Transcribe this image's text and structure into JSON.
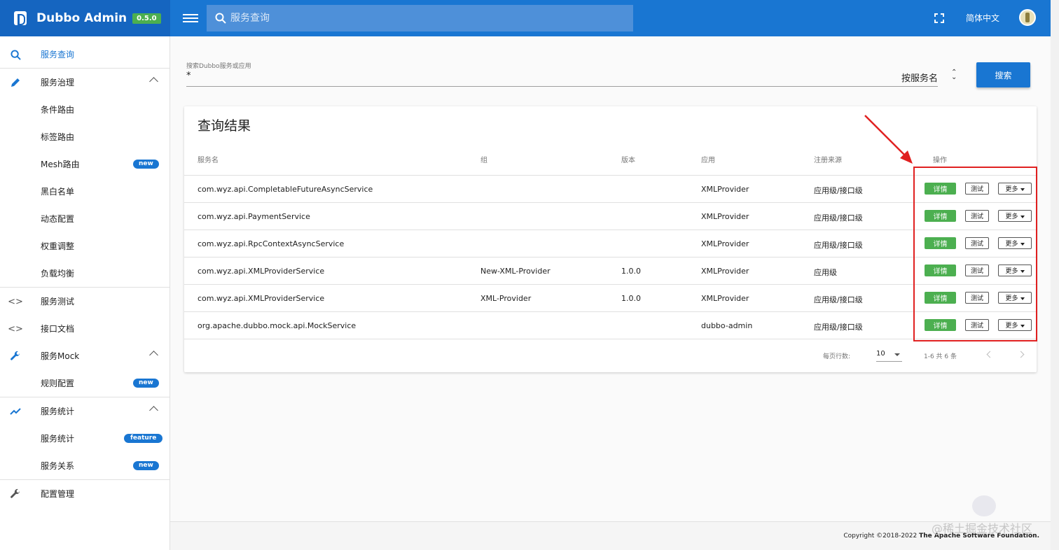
{
  "header": {
    "app_title": "Dubbo Admin",
    "version": "0.5.0",
    "search_placeholder": "服务查询",
    "language": "简体中文",
    "brand_color": "#1976d2"
  },
  "sidebar": {
    "items": [
      {
        "label": "服务查询",
        "icon": "search-icon"
      },
      {
        "label": "服务治理",
        "icon": "pencil-icon"
      },
      {
        "label": "条件路由"
      },
      {
        "label": "标签路由"
      },
      {
        "label": "Mesh路由",
        "badge": "new"
      },
      {
        "label": "黑白名单"
      },
      {
        "label": "动态配置"
      },
      {
        "label": "权重调整"
      },
      {
        "label": "负载均衡"
      },
      {
        "label": "服务测试",
        "icon": "code-icon"
      },
      {
        "label": "接口文档",
        "icon": "code-icon"
      },
      {
        "label": "服务Mock",
        "icon": "wrench-icon"
      },
      {
        "label": "规则配置",
        "badge": "new"
      },
      {
        "label": "服务统计",
        "icon": "trending-up-icon"
      },
      {
        "label": "服务统计",
        "badge": "feature"
      },
      {
        "label": "服务关系",
        "badge": "new"
      },
      {
        "label": "配置管理",
        "icon": "wrench-icon"
      }
    ]
  },
  "filter": {
    "label": "搜索Dubbo服务或应用",
    "value": "*",
    "mode": "按服务名",
    "search_button": "搜索"
  },
  "results": {
    "title": "查询结果",
    "columns": [
      "服务名",
      "组",
      "版本",
      "应用",
      "注册来源",
      "操作"
    ],
    "rows": [
      {
        "service": "com.wyz.api.CompletableFutureAsyncService",
        "group": "",
        "version": "",
        "app": "XMLProvider",
        "source": "应用级/接口级"
      },
      {
        "service": "com.wyz.api.PaymentService",
        "group": "",
        "version": "",
        "app": "XMLProvider",
        "source": "应用级/接口级"
      },
      {
        "service": "com.wyz.api.RpcContextAsyncService",
        "group": "",
        "version": "",
        "app": "XMLProvider",
        "source": "应用级/接口级"
      },
      {
        "service": "com.wyz.api.XMLProviderService",
        "group": "New-XML-Provider",
        "version": "1.0.0",
        "app": "XMLProvider",
        "source": "应用级"
      },
      {
        "service": "com.wyz.api.XMLProviderService",
        "group": "XML-Provider",
        "version": "1.0.0",
        "app": "XMLProvider",
        "source": "应用级/接口级"
      },
      {
        "service": "org.apache.dubbo.mock.api.MockService",
        "group": "",
        "version": "",
        "app": "dubbo-admin",
        "source": "应用级/接口级"
      }
    ],
    "actions": {
      "detail": "详情",
      "test": "测试",
      "more": "更多"
    },
    "pagination": {
      "rows_per_page_label": "每页行数:",
      "rows_per_page": "10",
      "range": "1-6 共 6 条"
    }
  },
  "footer": {
    "copyright_prefix": "Copyright ©2018-2022",
    "copyright_org": "The Apache Software Foundation."
  },
  "watermark": "@稀土掘金技术社区"
}
